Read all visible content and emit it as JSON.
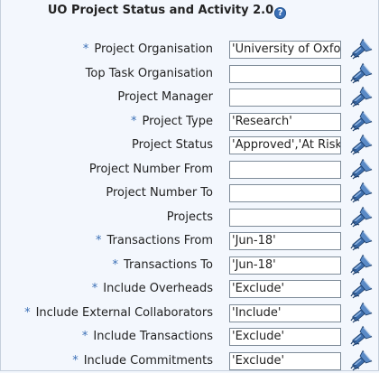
{
  "title": "UO Project Status and Activity 2.0",
  "help_icon": "help-icon",
  "lov_icon": "flashlight-search-icon",
  "required_marker": "*",
  "accent_color": "#3a6fb6",
  "params": [
    {
      "label": "Project Organisation",
      "required": true,
      "value": "'University of Oxford'"
    },
    {
      "label": "Top Task Organisation",
      "required": false,
      "value": ""
    },
    {
      "label": "Project Manager",
      "required": false,
      "value": ""
    },
    {
      "label": "Project Type",
      "required": true,
      "value": "'Research'"
    },
    {
      "label": "Project Status",
      "required": false,
      "value": "'Approved','At Risk','"
    },
    {
      "label": "Project Number From",
      "required": false,
      "value": ""
    },
    {
      "label": "Project Number To",
      "required": false,
      "value": ""
    },
    {
      "label": "Projects",
      "required": false,
      "value": ""
    },
    {
      "label": "Transactions From",
      "required": true,
      "value": "'Jun-18'"
    },
    {
      "label": "Transactions To",
      "required": true,
      "value": "'Jun-18'"
    },
    {
      "label": "Include Overheads",
      "required": true,
      "value": "'Exclude'"
    },
    {
      "label": "Include External Collaborators",
      "required": true,
      "value": "'Include'"
    },
    {
      "label": "Include Transactions",
      "required": true,
      "value": "'Exclude'"
    },
    {
      "label": "Include Commitments",
      "required": true,
      "value": "'Exclude'"
    }
  ]
}
